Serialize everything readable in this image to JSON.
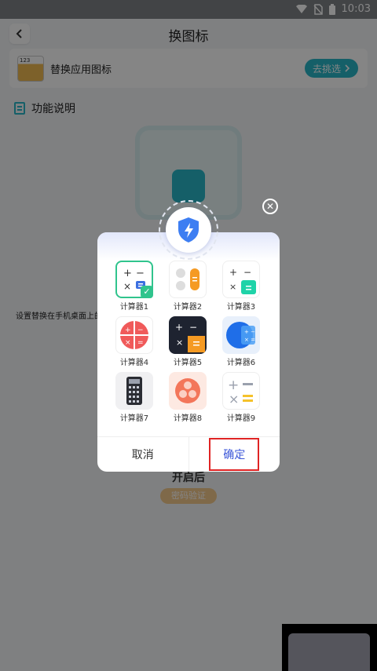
{
  "status_bar": {
    "time": "10:03"
  },
  "header": {
    "title": "换图标",
    "back_icon": "chevron-left-icon"
  },
  "replace_card": {
    "app_thumb_text": "123",
    "label": "替换应用图标",
    "pick_button": "去挑选",
    "pick_icon": "chevron-right-icon"
  },
  "function_section": {
    "title": "功能说明",
    "icon": "document-icon"
  },
  "description": "设置替换在手机桌面上的图标样式。",
  "below_dialog": {
    "title": "开启后",
    "pill": "密码验证"
  },
  "dialog": {
    "icons": [
      {
        "label": "计算器1",
        "selected": true
      },
      {
        "label": "计算器2",
        "selected": false
      },
      {
        "label": "计算器3",
        "selected": false
      },
      {
        "label": "计算器4",
        "selected": false
      },
      {
        "label": "计算器5",
        "selected": false
      },
      {
        "label": "计算器6",
        "selected": false
      },
      {
        "label": "计算器7",
        "selected": false
      },
      {
        "label": "计算器8",
        "selected": false
      },
      {
        "label": "计算器9",
        "selected": false
      }
    ],
    "cancel": "取消",
    "confirm": "确定"
  },
  "colors": {
    "accent": "#2ab6c7",
    "confirm": "#3b56d8",
    "highlight": "#e02424",
    "check": "#30c48d"
  }
}
